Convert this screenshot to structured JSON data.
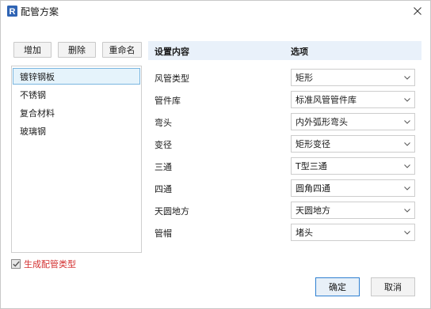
{
  "window": {
    "title": "配管方案",
    "app_icon": "revit-r-icon",
    "close_icon": "close-icon"
  },
  "toolbar": {
    "add_label": "增加",
    "delete_label": "删除",
    "rename_label": "重命名"
  },
  "schemes": {
    "selected_index": 0,
    "items": [
      {
        "label": "镀锌钢板"
      },
      {
        "label": "不锈钢"
      },
      {
        "label": "复合材料"
      },
      {
        "label": "玻璃钢"
      }
    ]
  },
  "settings": {
    "header": {
      "content_label": "设置内容",
      "option_label": "选项"
    },
    "rows": [
      {
        "label": "风管类型",
        "value": "矩形"
      },
      {
        "label": "管件库",
        "value": "标准风管管件库"
      },
      {
        "label": "弯头",
        "value": "内外弧形弯头"
      },
      {
        "label": "变径",
        "value": "矩形变径"
      },
      {
        "label": "三通",
        "value": "T型三通"
      },
      {
        "label": "四通",
        "value": "圆角四通"
      },
      {
        "label": "天圆地方",
        "value": "天圆地方"
      },
      {
        "label": "管帽",
        "value": "堵头"
      }
    ]
  },
  "generate_type": {
    "label": "生成配管类型",
    "checked": true,
    "label_color": "#d32f2f"
  },
  "footer": {
    "ok_label": "确定",
    "cancel_label": "取消"
  },
  "colors": {
    "accent": "#2f80d1",
    "header_bg": "#e9f1fa",
    "selection_bg": "#e5f3fb",
    "app_icon_bg": "#2f64b4"
  }
}
